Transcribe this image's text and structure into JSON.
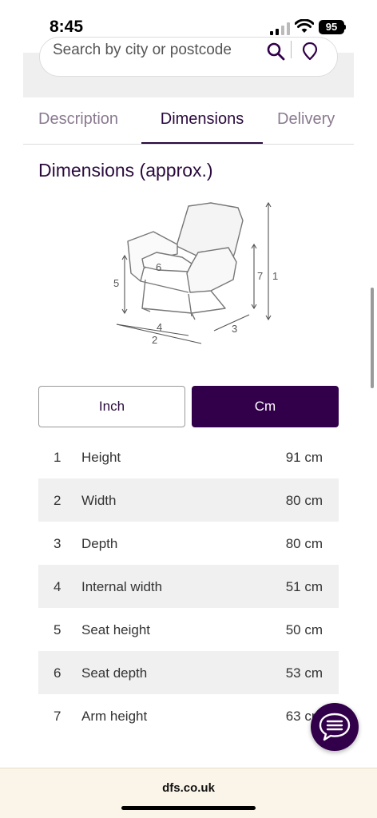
{
  "status": {
    "time": "8:45",
    "battery": "95"
  },
  "search": {
    "placeholder": "Search by city or postcode"
  },
  "tabs": [
    {
      "label": "Description"
    },
    {
      "label": "Dimensions"
    },
    {
      "label": "Delivery"
    }
  ],
  "section_title": "Dimensions (approx.)",
  "diagram": {
    "labels": [
      "1",
      "2",
      "3",
      "4",
      "5",
      "6",
      "7"
    ]
  },
  "units": {
    "inch": "Inch",
    "cm": "Cm",
    "selected": "Cm"
  },
  "dimensions": [
    {
      "num": "1",
      "label": "Height",
      "value": "91 cm"
    },
    {
      "num": "2",
      "label": "Width",
      "value": "80 cm"
    },
    {
      "num": "3",
      "label": "Depth",
      "value": "80 cm"
    },
    {
      "num": "4",
      "label": "Internal width",
      "value": "51 cm"
    },
    {
      "num": "5",
      "label": "Seat height",
      "value": "50 cm"
    },
    {
      "num": "6",
      "label": "Seat depth",
      "value": "53 cm"
    },
    {
      "num": "7",
      "label": "Arm height",
      "value": "63 cm"
    }
  ],
  "url": "dfs.co.uk",
  "colors": {
    "brand": "#32004a",
    "tab_active": "#2b0a3d",
    "tab_inactive": "#8a7a90"
  },
  "icons": [
    "signal-icon",
    "wifi-icon",
    "search-icon",
    "location-icon",
    "chat-icon"
  ]
}
